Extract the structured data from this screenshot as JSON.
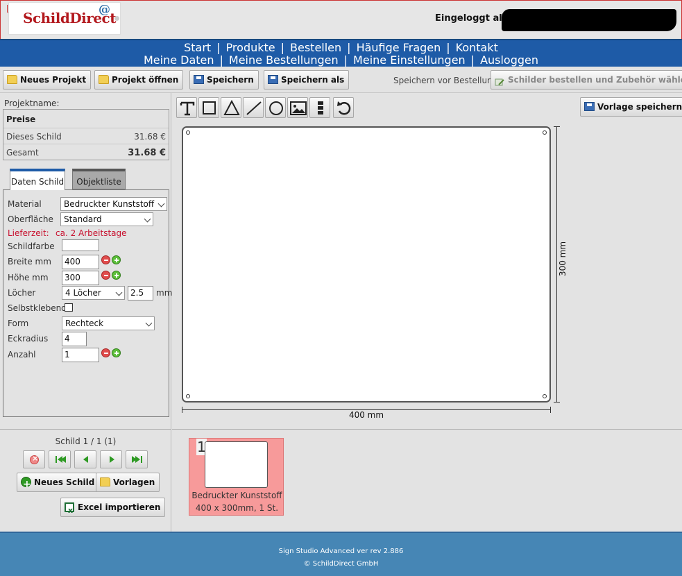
{
  "header": {
    "logo_text": "SchildDirect",
    "logo_at": "@",
    "login_label": "Eingeloggt als"
  },
  "nav": {
    "row1": [
      "Start",
      "Produkte",
      "Bestellen",
      "Häufige Fragen",
      "Kontakt"
    ],
    "row2": [
      "Meine Daten",
      "Meine Bestellungen",
      "Meine Einstellungen",
      "Ausloggen"
    ],
    "separator": "|"
  },
  "toolbar": {
    "new_project": "Neues Projekt",
    "open_project": "Projekt öffnen",
    "save": "Speichern",
    "save_as": "Speichern als",
    "pre_order_label": "Speichern vor Bestellung",
    "order": "Schilder bestellen und Zubehör wählen"
  },
  "project": {
    "name_label": "Projektname:",
    "prices_title": "Preise",
    "this_sign_label": "Dieses Schild",
    "this_sign_value": "31.68 €",
    "total_label": "Gesamt",
    "total_value": "31.68 €"
  },
  "tabs": {
    "data": "Daten Schild",
    "objects": "Objektliste"
  },
  "form": {
    "material_label": "Material",
    "material_value": "Bedruckter Kunststoff",
    "surface_label": "Oberfläche",
    "surface_value": "Standard",
    "delivery_label": "Lieferzeit:",
    "delivery_value": "ca. 2 Arbeitstage",
    "color_label": "Schildfarbe",
    "width_label": "Breite mm",
    "width_value": "400",
    "height_label": "Höhe mm",
    "height_value": "300",
    "holes_label": "Löcher",
    "holes_value": "4 Löcher",
    "hole_size_value": "2.5",
    "hole_unit": "mm",
    "selfadhesive_label": "Selbstklebend",
    "shape_label": "Form",
    "shape_value": "Rechteck",
    "corner_label": "Eckradius",
    "corner_value": "4",
    "count_label": "Anzahl",
    "count_value": "1"
  },
  "signs": {
    "counter": "Schild 1 / 1 (1)",
    "new_sign": "Neues Schild",
    "templates": "Vorlagen",
    "excel_import": "Excel importieren"
  },
  "editor": {
    "save_template": "Vorlage speichern",
    "width_dim": "400 mm",
    "height_dim": "300 mm",
    "tools": [
      "text-tool",
      "rectangle-tool",
      "triangle-tool",
      "line-tool",
      "circle-tool",
      "image-tool",
      "layers-tool",
      "undo-tool"
    ]
  },
  "thumbnail": {
    "number": "1",
    "line1": "Bedruckter Kunststoff",
    "line2": "400 x 300mm, 1 St."
  },
  "footer": {
    "version": "Sign Studio Advanced ver rev 2.886",
    "copyright": "© SchildDirect GmbH"
  },
  "colors": {
    "nav_blue": "#1e5ba7",
    "footer_blue": "#4686b5",
    "delivery_red": "#c8102e",
    "thumb_pink": "#f79a9a"
  }
}
